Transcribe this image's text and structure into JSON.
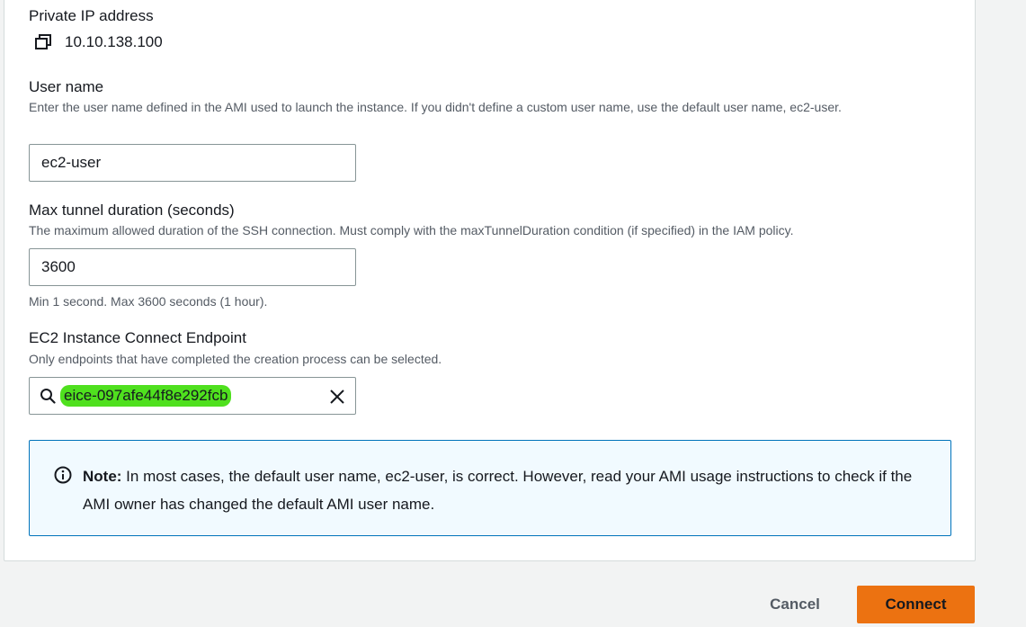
{
  "private_ip": {
    "label": "Private IP address",
    "value": "10.10.138.100",
    "copy_icon": "copy-icon"
  },
  "user_name": {
    "label": "User name",
    "description": "Enter the user name defined in the AMI used to launch the instance. If you didn't define a custom user name, use the default user name, ec2-user.",
    "value": "ec2-user"
  },
  "max_tunnel": {
    "label": "Max tunnel duration (seconds)",
    "description": "The maximum allowed duration of the SSH connection. Must comply with the maxTunnelDuration condition (if specified) in the IAM policy.",
    "value": "3600",
    "constraint": "Min 1 second. Max 3600 seconds (1 hour)."
  },
  "endpoint": {
    "label": "EC2 Instance Connect Endpoint",
    "description": "Only endpoints that have completed the creation process can be selected.",
    "value": "eice-097afe44f8e292fcb",
    "highlight_color": "#4fe01e",
    "search_icon": "search-icon",
    "clear_icon": "close-icon"
  },
  "note": {
    "bold": "Note:",
    "text": " In most cases, the default user name, ec2-user, is correct. However, read your AMI usage instructions to check if the AMI owner has changed the default AMI user name.",
    "icon": "info-icon"
  },
  "actions": {
    "cancel_label": "Cancel",
    "connect_label": "Connect",
    "primary_color": "#ec7211"
  }
}
